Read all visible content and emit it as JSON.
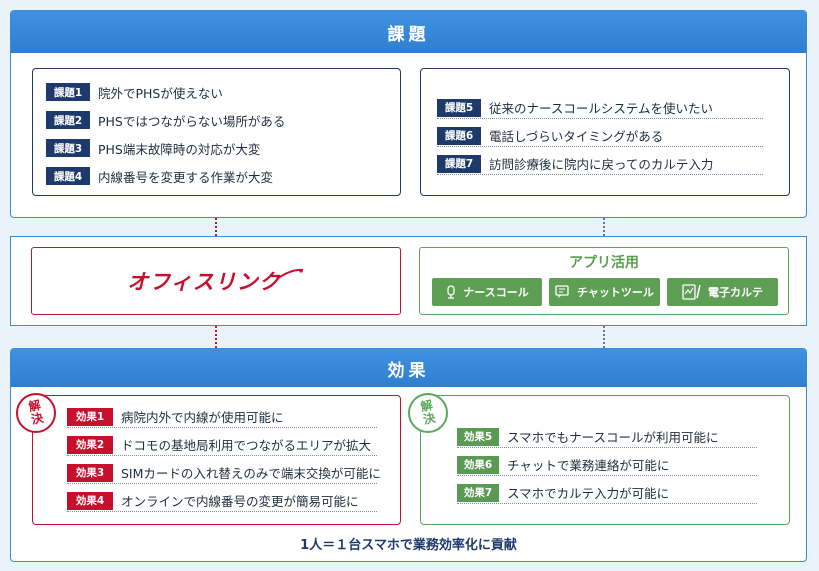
{
  "issues": {
    "header": "課題",
    "left": [
      {
        "tag": "課題1",
        "text": "院外でPHSが使えない"
      },
      {
        "tag": "課題2",
        "text": "PHSではつながらない場所がある"
      },
      {
        "tag": "課題3",
        "text": "PHS端末故障時の対応が大変"
      },
      {
        "tag": "課題4",
        "text": "内線番号を変更する作業が大変"
      }
    ],
    "right": [
      {
        "tag": "課題5",
        "text": "従来のナースコールシステムを使いたい"
      },
      {
        "tag": "課題6",
        "text": "電話しづらいタイミングがある"
      },
      {
        "tag": "課題7",
        "text": "訪問診療後に院内に戻ってのカルテ入力"
      }
    ]
  },
  "middle": {
    "logo": "オフィスリンク",
    "apps_title": "アプリ活用",
    "apps": [
      {
        "label": "ナースコール",
        "icon": "bell-icon"
      },
      {
        "label": "チャットツール",
        "icon": "chat-icon"
      },
      {
        "label": "電子カルテ",
        "icon": "tablet-pen-icon"
      }
    ]
  },
  "effects": {
    "header": "効果",
    "badge_text": "解決",
    "left": [
      {
        "tag": "効果1",
        "text": "病院内外で内線が使用可能に"
      },
      {
        "tag": "効果2",
        "text": "ドコモの基地局利用でつながるエリアが拡大"
      },
      {
        "tag": "効果3",
        "text": "SIMカードの入れ替えのみで端末交換が可能に"
      },
      {
        "tag": "効果4",
        "text": "オンラインで内線番号の変更が簡易可能に"
      }
    ],
    "right": [
      {
        "tag": "効果5",
        "text": "スマホでもナースコールが利用可能に"
      },
      {
        "tag": "効果6",
        "text": "チャットで業務連絡が可能に"
      },
      {
        "tag": "効果7",
        "text": "スマホでカルテ入力が可能に"
      }
    ],
    "summary": "1人＝１台スマホで業務効率化に貢献"
  },
  "colors": {
    "blue": "#3d8ad6",
    "navy": "#1e3a6b",
    "red": "#c8102e",
    "green": "#5b9a55"
  }
}
